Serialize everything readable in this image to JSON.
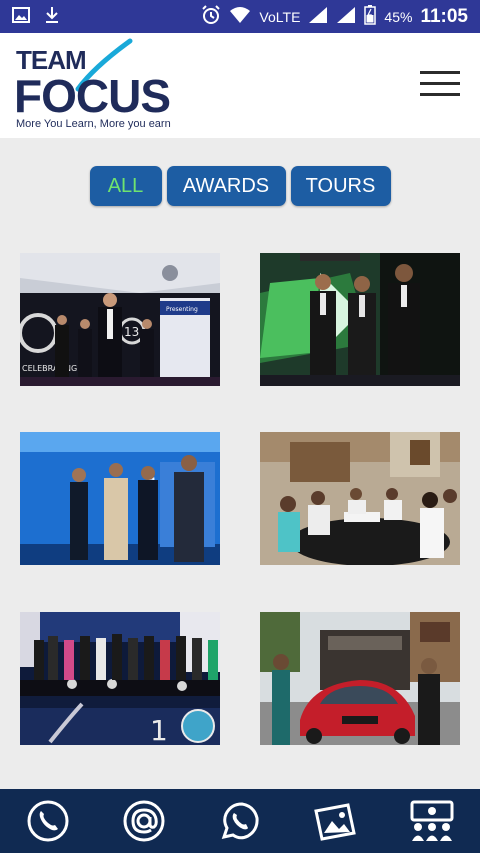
{
  "status_bar": {
    "network": "VoLTE",
    "battery": "45%",
    "time": "11:05"
  },
  "header": {
    "logo_line1": "TEAM",
    "logo_line2": "FOCUS",
    "tagline": "More You Learn, More you earn"
  },
  "tabs": [
    {
      "label": "ALL",
      "active": true
    },
    {
      "label": "AWARDS",
      "active": false
    },
    {
      "label": "TOURS",
      "active": false
    }
  ],
  "gallery": {
    "photos": [
      {
        "theme": "stage-speech"
      },
      {
        "theme": "stage-applause"
      },
      {
        "theme": "stage-blue"
      },
      {
        "theme": "banquet"
      },
      {
        "theme": "stage-group"
      },
      {
        "theme": "car-outdoor"
      }
    ],
    "photo_banners": {
      "banner_1": "Presenting",
      "counter_1": "13",
      "counter_5": "1",
      "stamp": "CELEBRATING"
    }
  },
  "bottom_bar": [
    {
      "icon": "phone-icon"
    },
    {
      "icon": "email-at-icon"
    },
    {
      "icon": "whatsapp-icon"
    },
    {
      "icon": "gallery-icon"
    },
    {
      "icon": "team-icon"
    }
  ],
  "colors": {
    "status_bar": "#2f3897",
    "tab_bg": "#1d5da3",
    "tab_active_text": "#6fe36f",
    "bottom_bar": "#102a52",
    "logo": "#1f2b5a",
    "logo_accent": "#19a9d9"
  }
}
